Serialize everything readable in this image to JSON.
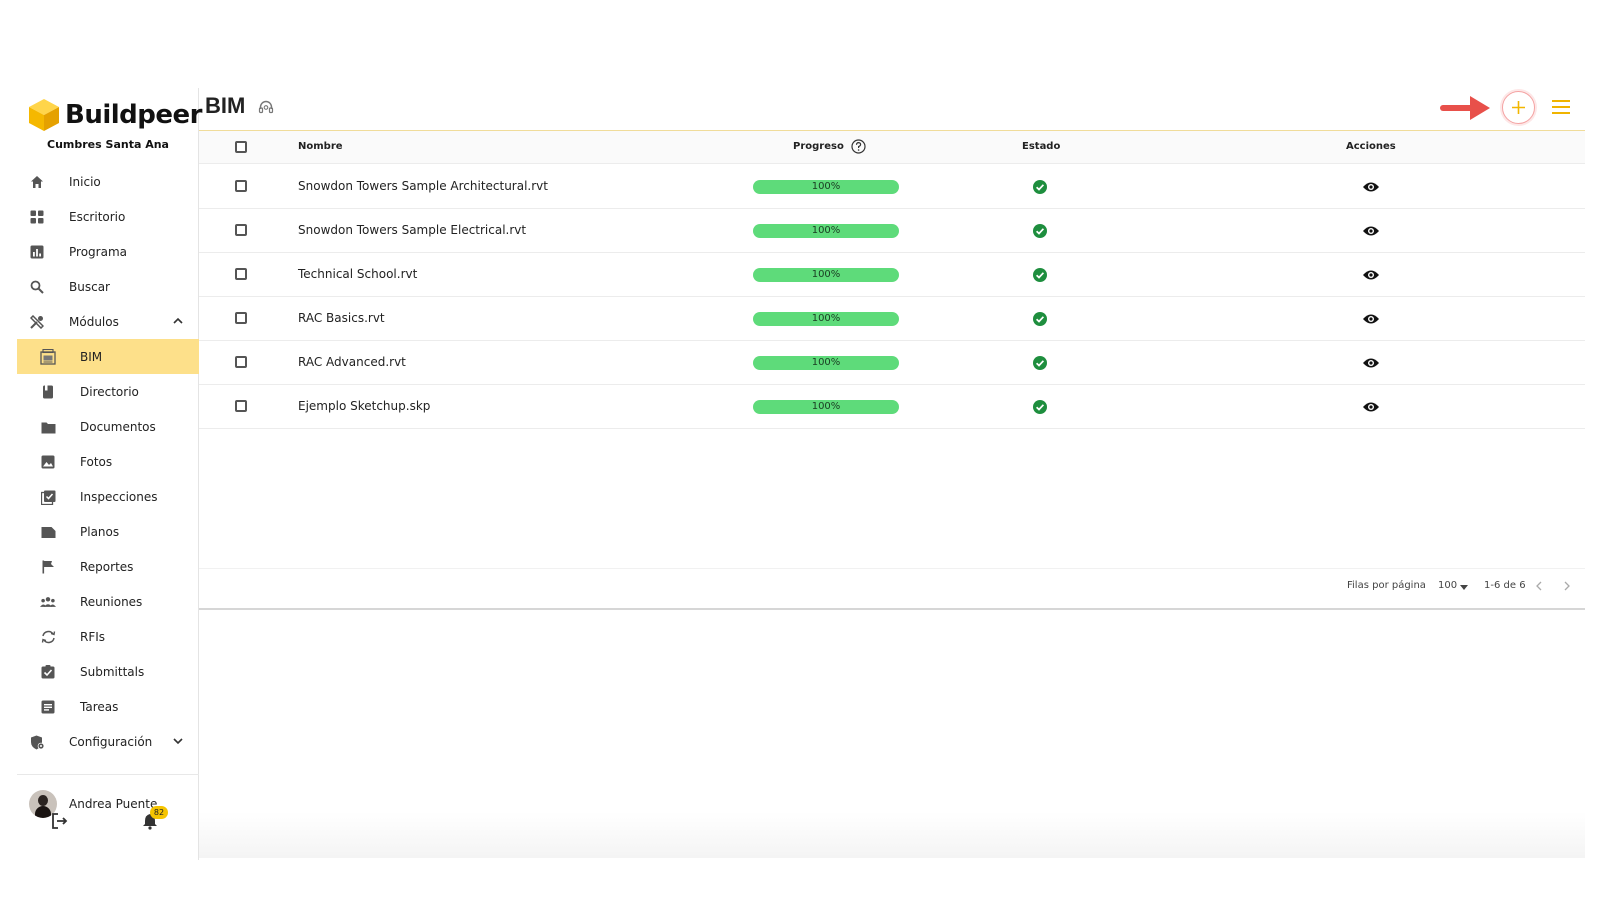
{
  "brand": {
    "name": "Buildpeer",
    "project": "Cumbres Santa Ana"
  },
  "nav": {
    "items": [
      {
        "label": "Inicio",
        "icon": "home-icon"
      },
      {
        "label": "Escritorio",
        "icon": "dashboard-icon"
      },
      {
        "label": "Programa",
        "icon": "chart-icon"
      },
      {
        "label": "Buscar",
        "icon": "search-icon"
      },
      {
        "label": "Módulos",
        "icon": "tools-icon",
        "expanded": true
      },
      {
        "label": "BIM",
        "icon": "bim-icon",
        "active": true
      },
      {
        "label": "Directorio",
        "icon": "book-icon"
      },
      {
        "label": "Documentos",
        "icon": "folder-icon"
      },
      {
        "label": "Fotos",
        "icon": "image-icon"
      },
      {
        "label": "Inspecciones",
        "icon": "checklist-icon"
      },
      {
        "label": "Planos",
        "icon": "plans-icon"
      },
      {
        "label": "Reportes",
        "icon": "flag-icon"
      },
      {
        "label": "Reuniones",
        "icon": "people-icon"
      },
      {
        "label": "RFIs",
        "icon": "sync-icon"
      },
      {
        "label": "Submittals",
        "icon": "check-box-icon"
      },
      {
        "label": "Tareas",
        "icon": "task-icon"
      },
      {
        "label": "Configuración",
        "icon": "settings-icon",
        "expanded": false
      }
    ]
  },
  "user": {
    "name": "Andrea Puente",
    "notifications": "82"
  },
  "header": {
    "title": "BIM"
  },
  "table": {
    "columns": {
      "name": "Nombre",
      "progress": "Progreso",
      "status": "Estado",
      "actions": "Acciones"
    },
    "rows": [
      {
        "name": "Snowdon Towers Sample Architectural.rvt",
        "progress": "100%",
        "status": "complete"
      },
      {
        "name": "Snowdon Towers Sample Electrical.rvt",
        "progress": "100%",
        "status": "complete"
      },
      {
        "name": "Technical School.rvt",
        "progress": "100%",
        "status": "complete"
      },
      {
        "name": "RAC Basics.rvt",
        "progress": "100%",
        "status": "complete"
      },
      {
        "name": "RAC Advanced.rvt",
        "progress": "100%",
        "status": "complete"
      },
      {
        "name": "Ejemplo Sketchup.skp",
        "progress": "100%",
        "status": "complete"
      }
    ]
  },
  "pagination": {
    "rows_per_page_label": "Filas por página",
    "rows_per_page": "100",
    "range": "1-6 de 6"
  },
  "colors": {
    "accent": "#f5c400",
    "active_nav": "#fde08a",
    "progress": "#5edb7a",
    "status_ok": "#1e8e3e",
    "arrow": "#e8504a"
  }
}
